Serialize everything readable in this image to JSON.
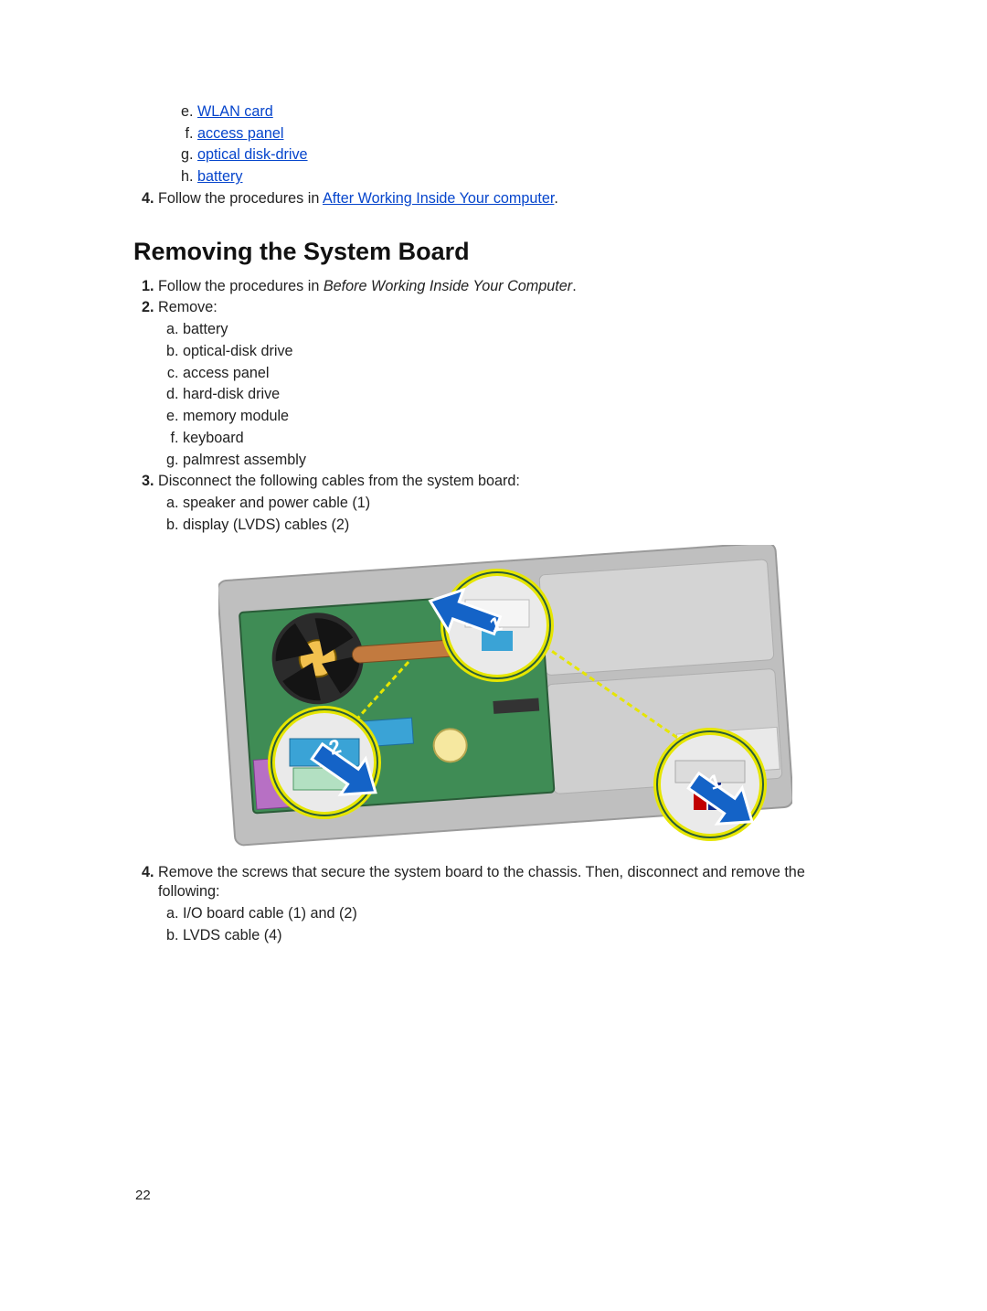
{
  "topList": {
    "start": 5,
    "items": [
      {
        "type": "link",
        "text": "WLAN card"
      },
      {
        "type": "link",
        "text": "access panel"
      },
      {
        "type": "link",
        "text": "optical disk-drive"
      },
      {
        "type": "link",
        "text": "battery"
      }
    ]
  },
  "followStep": {
    "number": "4.",
    "prefix": "Follow the procedures in ",
    "link": "After Working Inside Your computer",
    "suffix": "."
  },
  "heading": "Removing the System Board",
  "steps": {
    "s1": {
      "prefix": "Follow the procedures in ",
      "italic": "Before Working Inside Your Computer",
      "suffix": "."
    },
    "s2": {
      "text": "Remove:",
      "sub": [
        "battery",
        "optical-disk drive",
        "access panel",
        "hard-disk drive",
        "memory module",
        "keyboard",
        "palmrest assembly"
      ]
    },
    "s3": {
      "text": "Disconnect the following cables from the system board:",
      "sub": [
        "speaker and power cable (1)",
        "display (LVDS) cables (2)"
      ]
    },
    "s4": {
      "text": "Remove the screws that secure the system board to the chassis. Then, disconnect and remove the following:",
      "sub": [
        "I/O board cable (1) and (2)",
        "LVDS cable (4)"
      ]
    }
  },
  "pageNumber": "22"
}
